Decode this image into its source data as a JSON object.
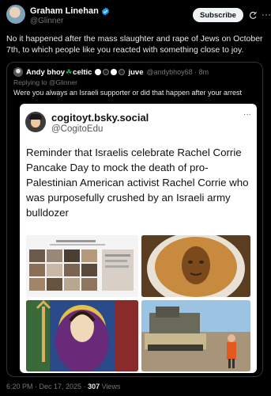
{
  "author": {
    "name": "Graham Linehan",
    "handle": "@Glinner",
    "subscribe_label": "Subscribe"
  },
  "post_text": "No it happened after the mass slaughter and rape of Jews on October 7th, to which people like you reacted with something close to joy.",
  "quote": {
    "name": "Andy bhoy",
    "name_suffix": "celtic",
    "name_tail": "juve",
    "handle_time": "@andybhoy68 · 8m",
    "replying_to": "Replying to @Glinner",
    "text": "Were you always an Israeli supporter or did that happen after your arrest"
  },
  "embedded": {
    "site_name": "cogitoyt.bsky.social",
    "handle": "@CogitoEdu",
    "text": "Reminder that Israelis celebrate Rachel Corrie Pancake Day to mock the death of pro-Palestinian American activist Rachel Corrie who was purposefully crushed by an Israeli army bulldozer"
  },
  "footer": {
    "timestamp": "6:20 PM · Dec 17, 2025 · ",
    "views_count": "307",
    "views_label": " Views"
  },
  "icons": {
    "verified": "verified-badge-icon",
    "grok": "grok-icon",
    "more": "more-icon",
    "shamrock": "shamrock-icon"
  },
  "colors": {
    "background": "#000000",
    "verified": "#1d9bf0",
    "muted": "#71767b",
    "shamrock": "#27ae60"
  }
}
